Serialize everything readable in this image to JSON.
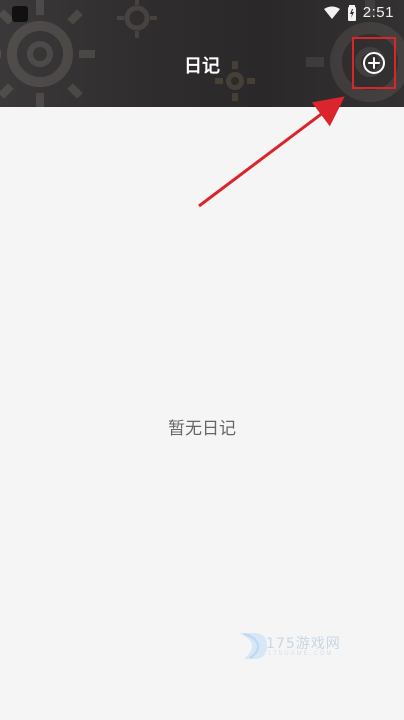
{
  "status_bar": {
    "time": "2:51"
  },
  "header": {
    "title": "日记",
    "add_button_icon": "plus-circle-icon"
  },
  "main": {
    "empty_message": "暂无日记"
  },
  "watermark": {
    "text": "175游戏网",
    "subtext": "175GAME.COM"
  },
  "colors": {
    "header_bg": "#2f2d2d",
    "page_bg": "#f5f5f5",
    "annotation_red": "#d9252b"
  }
}
